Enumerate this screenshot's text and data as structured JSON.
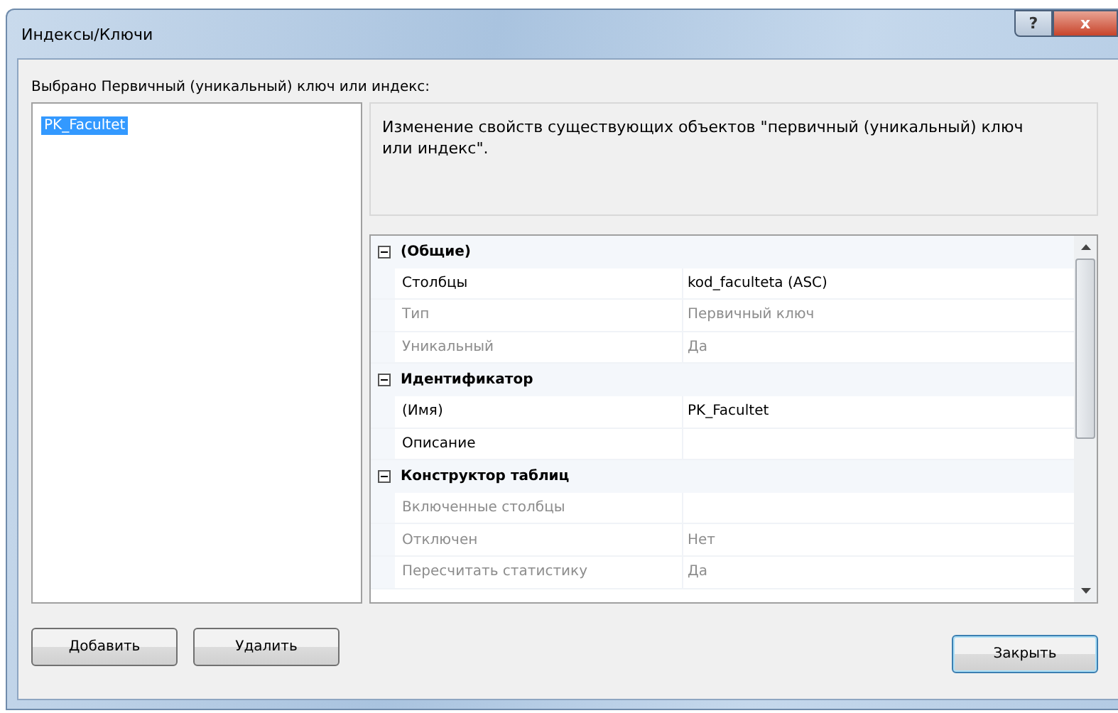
{
  "window": {
    "title": "Индексы/Ключи",
    "help_button": "?",
    "close_button": "x"
  },
  "selected_label": "Выбрано Первичный (уникальный) ключ или индекс:",
  "keys": [
    {
      "label": "PK_Facultet",
      "selected": true
    }
  ],
  "description": "Изменение свойств существующих объектов \"первичный (уникальный) ключ или индекс\".",
  "properties": [
    {
      "category": "(Общие)",
      "expanded": true,
      "rows": [
        {
          "name": "Столбцы",
          "value": "kod_faculteta (ASC)",
          "disabled": false
        },
        {
          "name": "Тип",
          "value": "Первичный ключ",
          "disabled": true
        },
        {
          "name": "Уникальный",
          "value": "Да",
          "disabled": true
        }
      ]
    },
    {
      "category": "Идентификатор",
      "expanded": true,
      "rows": [
        {
          "name": "(Имя)",
          "value": "PK_Facultet",
          "disabled": false
        },
        {
          "name": "Описание",
          "value": "",
          "disabled": false
        }
      ]
    },
    {
      "category": "Конструктор таблиц",
      "expanded": true,
      "rows": [
        {
          "name": "Включенные столбцы",
          "value": "",
          "disabled": true
        },
        {
          "name": "Отключен",
          "value": "Нет",
          "disabled": true
        },
        {
          "name": "Пересчитать статистику",
          "value": "Да",
          "disabled": true
        }
      ]
    }
  ],
  "left_buttons": [
    "Добавить",
    "Удалить"
  ],
  "close_label": "Закрыть"
}
